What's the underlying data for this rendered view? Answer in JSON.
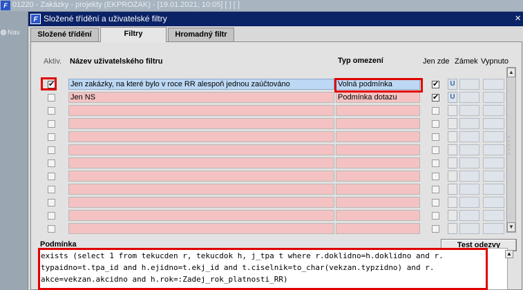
{
  "background_window": {
    "icon_text": "F",
    "title": "01220 - Zakázky - projekty (EKPROZAK) - [19.01.2021; 10:05] [ ] [ ]",
    "nav_label": "Nav"
  },
  "dialog": {
    "icon_text": "F",
    "title": "Složené třídění a uživatelské filtry",
    "close_label": "×"
  },
  "tabs": [
    {
      "label": "Složené třídění",
      "active": false
    },
    {
      "label": "Filtry",
      "active": true
    },
    {
      "label": "Hromadný filtr",
      "active": false
    }
  ],
  "columns": {
    "aktiv": "Aktiv.",
    "name": "Název uživatelského filtru",
    "type": "Typ omezení",
    "jen_zde": "Jen zde",
    "zamek": "Zámek",
    "vypnuto": "Vypnuto"
  },
  "filters": [
    {
      "aktiv": true,
      "name": "Jen zakázky, na které bylo v roce RR alespoň jednou zaúčtováno",
      "type": "Volná podmínka",
      "jen_zde": true,
      "lock": "U",
      "selected": true
    },
    {
      "aktiv": false,
      "name": "Jen NS",
      "type": "Podmínka dotazu",
      "jen_zde": true,
      "lock": "U",
      "selected": false
    },
    {
      "aktiv": false,
      "name": "",
      "type": "",
      "jen_zde": false,
      "lock": "",
      "selected": false
    },
    {
      "aktiv": false,
      "name": "",
      "type": "",
      "jen_zde": false,
      "lock": "",
      "selected": false
    },
    {
      "aktiv": false,
      "name": "",
      "type": "",
      "jen_zde": false,
      "lock": "",
      "selected": false
    },
    {
      "aktiv": false,
      "name": "",
      "type": "",
      "jen_zde": false,
      "lock": "",
      "selected": false
    },
    {
      "aktiv": false,
      "name": "",
      "type": "",
      "jen_zde": false,
      "lock": "",
      "selected": false
    },
    {
      "aktiv": false,
      "name": "",
      "type": "",
      "jen_zde": false,
      "lock": "",
      "selected": false
    },
    {
      "aktiv": false,
      "name": "",
      "type": "",
      "jen_zde": false,
      "lock": "",
      "selected": false
    },
    {
      "aktiv": false,
      "name": "",
      "type": "",
      "jen_zde": false,
      "lock": "",
      "selected": false
    },
    {
      "aktiv": false,
      "name": "",
      "type": "",
      "jen_zde": false,
      "lock": "",
      "selected": false
    },
    {
      "aktiv": false,
      "name": "",
      "type": "",
      "jen_zde": false,
      "lock": "",
      "selected": false
    }
  ],
  "test_button_label": "Test odezvy",
  "condition": {
    "label": "Podmínka",
    "lines": [
      "exists (select 1 from tekucden r, tekucdok h, j_tpa t where r.doklidno=h.doklidno and r.",
      "typaidno=t.tpa_id and h.ejidno=t.ekj_id and t.ciselnik=to_char(vekzan.typzidno) and r.",
      "akce=vekzan.akcidno and h.rok=:Zadej_rok_platnosti_RR)"
    ]
  },
  "icons": {
    "scroll_up": "▲",
    "scroll_down": "▼"
  },
  "colors": {
    "highlight": "#e00000",
    "dialog_titlebar": "#0a2266",
    "row_pink": "#f4c2c2",
    "row_selected": "#bcd8f4"
  }
}
